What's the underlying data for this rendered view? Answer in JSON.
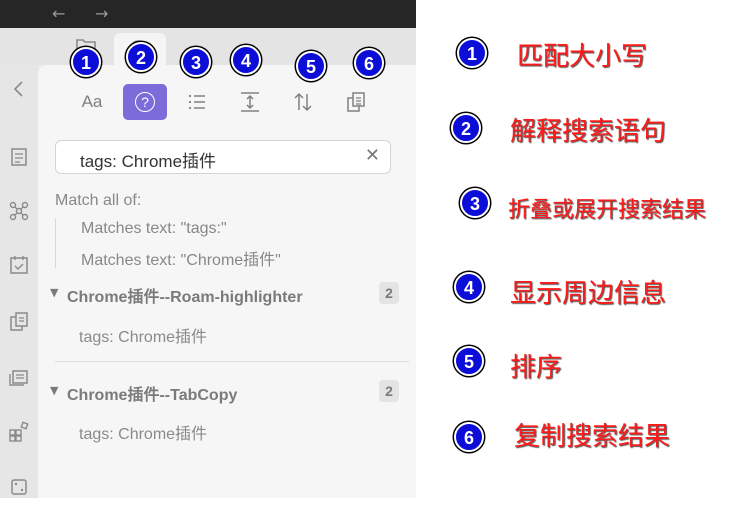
{
  "nav": {
    "back": "←",
    "forward": "→"
  },
  "toolbar": [
    {
      "id": "match-case",
      "label": "Aa",
      "badge": "1",
      "annotation": "匹配大小写"
    },
    {
      "id": "explain",
      "label": "?",
      "badge": "2",
      "annotation": "解释搜索语句",
      "active": true
    },
    {
      "id": "collapse",
      "badge": "3",
      "annotation": "折叠或展开搜索结果"
    },
    {
      "id": "context",
      "badge": "4",
      "annotation": "显示周边信息"
    },
    {
      "id": "sort",
      "badge": "5",
      "annotation": "排序"
    },
    {
      "id": "copy",
      "badge": "6",
      "annotation": "复制搜索结果"
    }
  ],
  "search": {
    "value": "tags: Chrome插件",
    "clear": "✕"
  },
  "explanation": {
    "heading": "Match all of:",
    "lines": [
      "Matches text: \"tags:\"",
      "Matches text: \"Chrome插件\""
    ]
  },
  "results": [
    {
      "title": "Chrome插件--Roam-highlighter",
      "count": "2",
      "match": "tags: Chrome插件"
    },
    {
      "title": "Chrome插件--TabCopy",
      "count": "2",
      "match": "tags: Chrome插件"
    }
  ],
  "colors": {
    "accent": "#7b6cd9",
    "badge": "#0d0dd8",
    "annotation": "#ff1a1a"
  }
}
